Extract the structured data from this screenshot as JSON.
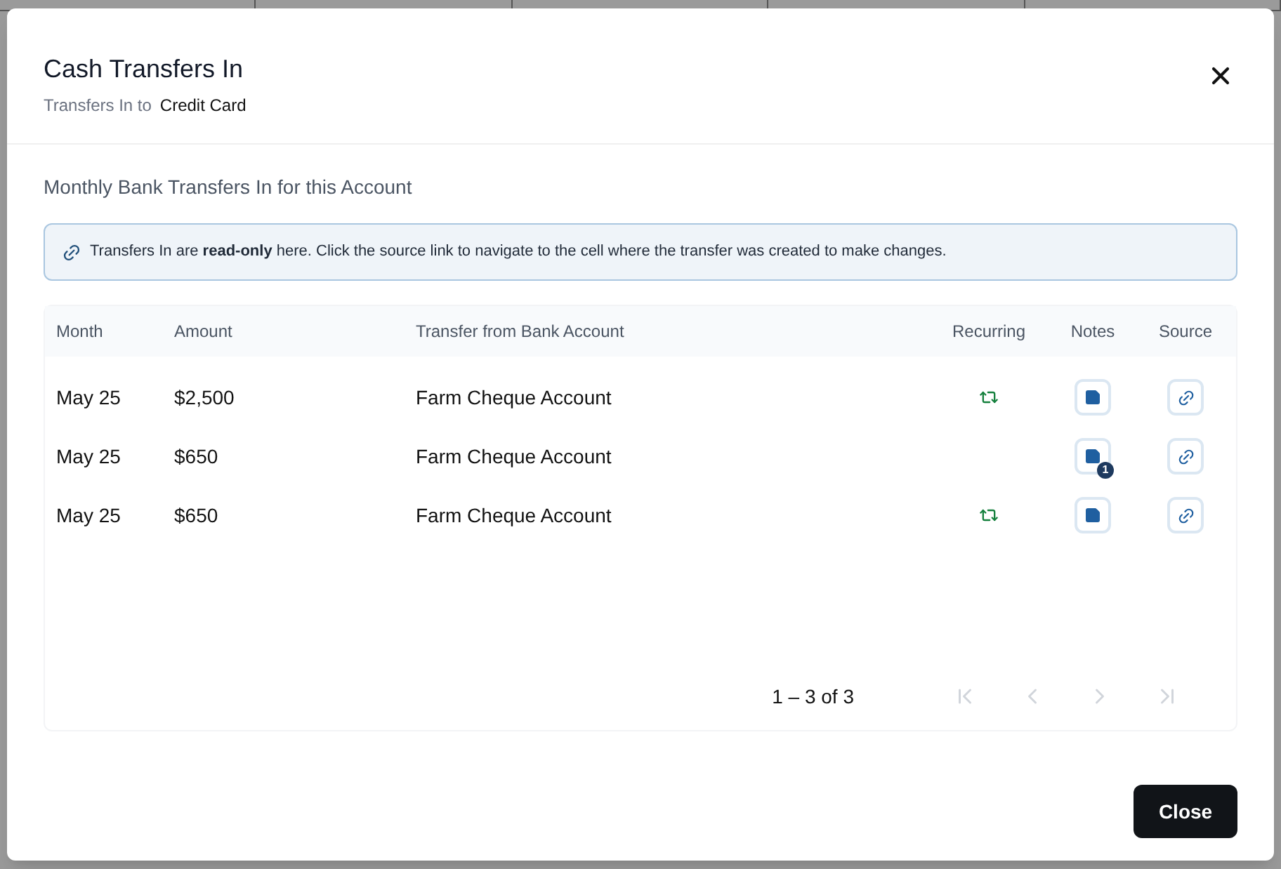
{
  "dialog": {
    "title": "Cash Transfers In",
    "subtitle_label": "Transfers In to",
    "subtitle_value": "Credit Card",
    "section_title": "Monthly Bank Transfers In for this Account",
    "info": "Transfers In are **read-only** here. Click the source link to navigate to the cell where the transfer was created to make changes.",
    "table": {
      "columns": [
        "Month",
        "Amount",
        "Transfer from Bank Account",
        "Recurring",
        "Notes",
        "Source"
      ],
      "rows": [
        {
          "month": "May 25",
          "amount": "$2,500",
          "account": "Farm Cheque Account",
          "recurring": true
        },
        {
          "month": "May 25",
          "amount": "$650",
          "account": "Farm Cheque Account",
          "recurring": false,
          "notes_badge": "1"
        },
        {
          "month": "May 25",
          "amount": "$650",
          "account": "Farm Cheque Account",
          "recurring": true
        }
      ]
    },
    "pagination": {
      "range": "1 – 3 of 3",
      "first_disabled": true,
      "prev_disabled": true,
      "next_disabled": true,
      "last_disabled": true
    },
    "close_button": "Close"
  }
}
